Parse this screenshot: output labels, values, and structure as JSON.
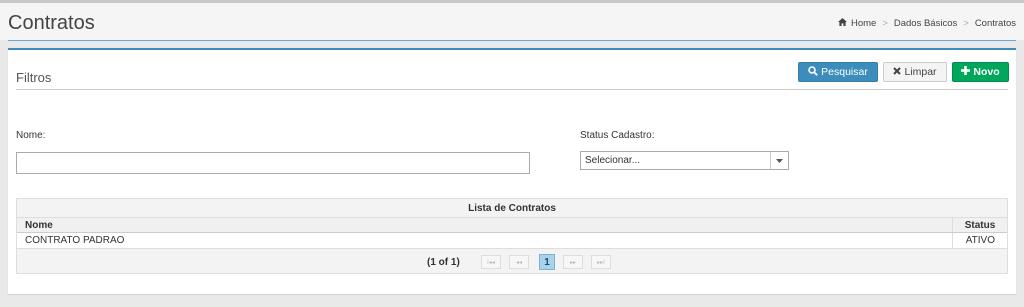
{
  "header": {
    "title": "Contratos",
    "breadcrumb": [
      "Home",
      "Dados Básicos",
      "Contratos"
    ]
  },
  "filters": {
    "title": "Filtros",
    "buttons": {
      "search": "Pesquisar",
      "clear": "Limpar",
      "new": "Novo"
    },
    "name_label": "Nome:",
    "name_value": "",
    "status_label": "Status Cadastro:",
    "status_value": "Selecionar..."
  },
  "table": {
    "caption": "Lista de Contratos",
    "columns": [
      "Nome",
      "Status"
    ],
    "rows": [
      [
        "CONTRATO PADRAO",
        "ATIVO"
      ]
    ],
    "pager": {
      "info": "(1 of 1)",
      "current_page": "1",
      "first": "I◂◂",
      "prev": "◂◂",
      "next": "▸▸",
      "last": "▸▸I"
    }
  },
  "colors": {
    "primary": "#3c8dbc",
    "success": "#00a65a",
    "default": "#f4f4f4"
  }
}
